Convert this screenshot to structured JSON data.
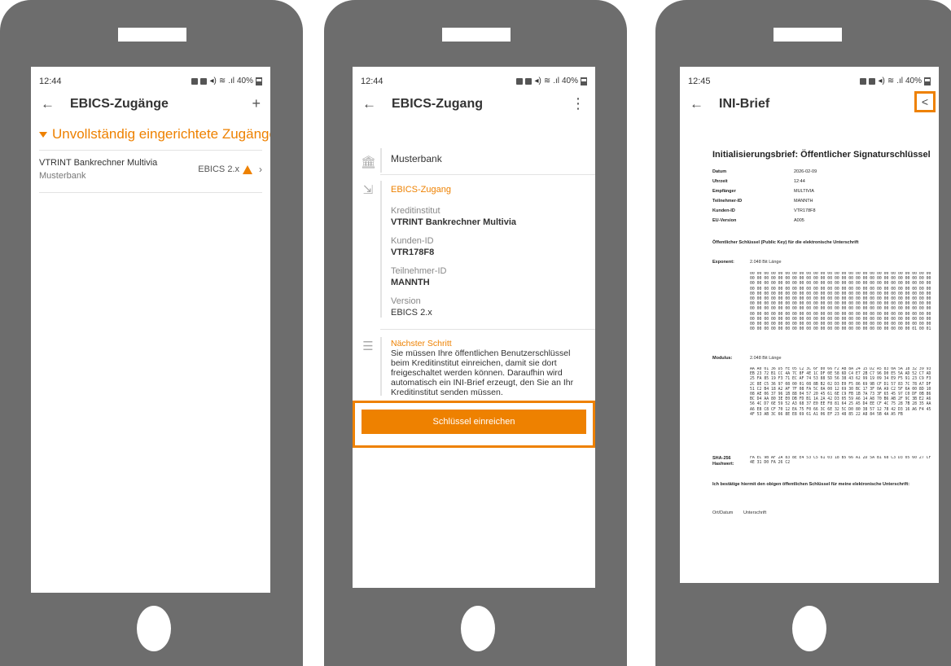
{
  "phone1": {
    "status_time": "12:44",
    "status_battery": "40%",
    "title": "EBICS-Zugänge",
    "add_icon": "+",
    "section_title": "Unvollständig eingerichtete Zugänge",
    "account": {
      "name": "VTRINT Bankrechner Multivia",
      "bank": "Musterbank",
      "version": "EBICS 2.x"
    }
  },
  "phone2": {
    "status_time": "12:44",
    "status_battery": "40%",
    "title": "EBICS-Zugang",
    "bank_name": "Musterbank",
    "section_head": "EBICS-Zugang",
    "fields": [
      {
        "label": "Kreditinstitut",
        "value": "VTRINT Bankrechner Multivia"
      },
      {
        "label": "Kunden-ID",
        "value": "VTR178F8"
      },
      {
        "label": "Teilnehmer-ID",
        "value": "MANNTH"
      },
      {
        "label": "Version",
        "value": "EBICS 2.x"
      }
    ],
    "next_step_head": "Nächster Schritt",
    "next_step_text": "Sie müssen Ihre öffentlichen Benutzerschlüssel beim Kreditinstitut einreichen, damit sie dort freigeschaltet werden können. Daraufhin wird automatisch ein INI-Brief erzeugt, den Sie an Ihr Kreditinstitut senden müssen.",
    "button_label": "Schlüssel einreichen"
  },
  "phone3": {
    "status_time": "12:45",
    "status_battery": "40%",
    "title": "INI-Brief",
    "doc_title": "Initialisierungsbrief: Öffentlicher Signaturschlüssel",
    "meta": [
      {
        "k": "Datum",
        "v": "2026-02-09"
      },
      {
        "k": "Uhrzeit",
        "v": "12:44"
      },
      {
        "k": "Empfänger",
        "v": "MULTIVIA"
      },
      {
        "k": "Teilnehmer-ID",
        "v": "MANNTH"
      },
      {
        "k": "Kunden-ID",
        "v": "VTR178F8"
      },
      {
        "k": "EU-Version",
        "v": "A005"
      }
    ],
    "public_key_heading": "Öffentlicher Schlüssel (Public Key) für die elektronische Unterschrift",
    "exponent_label": "Exponent:",
    "exponent_bits": "2.048 Bit Länge",
    "exponent_hex": "00 00 00 00 00 00 00 00 00 00 00 00 00 00 00 00 00 00 00 00 00 00 00 00 00 00 00 00 00 00 00 00 00 00 00 00 00 00 00 00 00 00 00 00 00 00 00 00 00 00 00 00 00 00 00 00 00 00 00 00 00 00 00 00 00 00 00 00 00 00 00 00 00 00 00 00 00 00 00 00 00 00 00 00 00 00 00 00 00 00 00 00 00 00 00 00 00 00 00 00 00 00 00 00 00 00 00 00 00 00 00 00 00 00 00 00 00 00 00 00 00 00 00 00 00 00 00 00 00 00 00 00 00 00 00 00 00 00 00 00 00 00 00 00 00 00 00 00 00 00 00 00 00 00 00 00 00 00 00 00 00 00 00 00 00 00 00 00 00 00 00 00 00 00 00 00 00 00 00 00 00 00 00 00 00 00 00 00 00 00 00 00 00 00 00 00 00 00 00 00 00 00 00 00 00 00 00 00 00 00 00 00 00 00 00 00 00 00 00 00 00 00 00 00 00 00 00 00 00 00 00 00 00 00 00 00 00 00 00 00 00 00 00 00 00 00 00 00 00 00 00 00 00 00 00 00 00 00 00 00 00 00 00 00 00 00 00 00 00 00 00 00 00 00 00 00 00 00 00 00 00 00 00 00 00 00 00 00 00 00 00 00 00 00 00 00 00 00 00 00 00 00 00 00 00 00 00 00 00 01 00 01",
    "modulus_label": "Modulus:",
    "modulus_bits": "2.048 Bit Länge",
    "modulus_hex": "AA A0 01 36 D5 FE 05 C2 3C 6F 80 66 F2 AB 8A 24 15 D2 A5 83 0A 5A 18 32 39 93 EB 23 72 B1 CC 4A 7C 8F 4E 1C DF 0E 58 6D C4 E7 2B C7 96 D0 E5 5A AD 52 C7 AD 25 FA 85 19 F3 71 EC AF 74 53 88 5D 56 38 43 62 99 19 09 34 E9 F5 91 23 C9 F3 2C 8E C5 36 97 08 00 01 08 8B B2 02 D3 E0 F5 86 69 9B CF D1 57 83 7C 78 A7 DF 51 C2 B4 18 A2 AF 7F 08 FA 5C 0A 00 12 69 30 BC 17 3F 0A A9 C2 5F 6A 00 8D 10 08 AE 06 37 96 1B 88 04 57 20 45 61 6E C9 FB 1B 7A 73 3F 65 45 97 C0 DF 0B 86 BC D4 AA 80 3E E0 DB FD B1 1A 2A 42 D3 05 59 A6 14 A8 70 B6 AB 2F 9C 3B E2 A6 56 4C D7 6E 59 52 A3 68 37 E0 EE F8 81 64 25 A5 D4 EE CF 4C 75 28 7B 28 35 AA A6 E8 C8 CF 70 12 EA 75 F0 66 3C 6E 32 5C D0 80 38 57 12 78 42 D3 16 A6 F4 45 4F 53 AB 3C 66 8E E8 69 61 A1 06 EF 23 48 85 22 A8 84 5B 4A A5 FB",
    "sha_label": "SHA-256 Hashwert:",
    "sha_hex": "FA EC 9B AF 2A 83 8E E4 53 C5 61 03 18 B5 66 A1 2D 5A B1 68 C3 D3 05 60 27 CF 4E 31 D0 FA 26 C2",
    "confirm_text": "Ich bestätige hiermit den obigen öffentlichen Schlüssel für meine elektronische Unterschrift:",
    "place_date": "Ort/Datum",
    "signature": "Unterschrift"
  },
  "colors": {
    "accent": "#ee8100",
    "phone_body": "#6d6d6d"
  }
}
